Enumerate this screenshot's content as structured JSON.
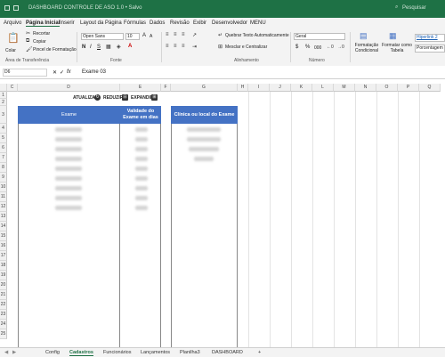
{
  "window": {
    "title": "DASHBOARD CONTROLE DE ASO 1.0 • Salvo",
    "search": "Pesquisar"
  },
  "menu": {
    "items": [
      "Arquivo",
      "Página Inicial",
      "Inserir",
      "Layout da Página",
      "Fórmulas",
      "Dados",
      "Revisão",
      "Exibir",
      "Desenvolvedor",
      "MENU"
    ]
  },
  "ribbon": {
    "clipboard": {
      "paste": "Colar",
      "cut": "Recortar",
      "copy": "Copiar",
      "format_painter": "Pincel de Formatação",
      "group": "Área de Transferência"
    },
    "font": {
      "name": "Open Sans",
      "size": "10",
      "bold": "N",
      "italic": "I",
      "underline": "S",
      "group": "Fonte"
    },
    "alignment": {
      "wrap": "Quebrar Texto Automaticamente",
      "merge": "Mesclar e Centralizar",
      "group": "Alinhamento"
    },
    "number": {
      "format": "Geral",
      "currency": "$",
      "percent": "%",
      "thousands": "000",
      "group": "Número"
    },
    "styles": {
      "conditional": "Formatação Condicional",
      "table": "Formatar como Tabela",
      "style1": "Hiperlink 2",
      "style2": "Porcentagem 2"
    }
  },
  "formula_bar": {
    "cell_ref": "D6",
    "fx": "fx",
    "content": "Exame 03"
  },
  "buttons": {
    "update": "ATUALIZAR",
    "reduce": "REDUZIR",
    "expand": "EXPANDIR"
  },
  "columns": [
    "C",
    "D",
    "E",
    "F",
    "G",
    "H",
    "I",
    "J",
    "K",
    "L",
    "M",
    "N",
    "O",
    "P",
    "Q"
  ],
  "rows": [
    "1",
    "2",
    "3",
    "4",
    "5",
    "6",
    "7",
    "8",
    "9",
    "10",
    "11",
    "12",
    "13",
    "14",
    "15",
    "16",
    "17",
    "18",
    "19",
    "20",
    "21",
    "22",
    "23",
    "24",
    "25"
  ],
  "table": {
    "h_exame": "Exame",
    "h_validade": "Validade do Exame em dias",
    "h_clinica": "Clínica ou local do Exame"
  },
  "sheet_tabs": {
    "items": [
      "Config",
      "Cadastros",
      "Funcionários",
      "Lançamentos",
      "Planilha3",
      "DASHBOARD"
    ],
    "active": "Cadastros",
    "add": "+"
  },
  "colors": {
    "excel_green": "#1e7145",
    "table_header": "#4472c4"
  }
}
